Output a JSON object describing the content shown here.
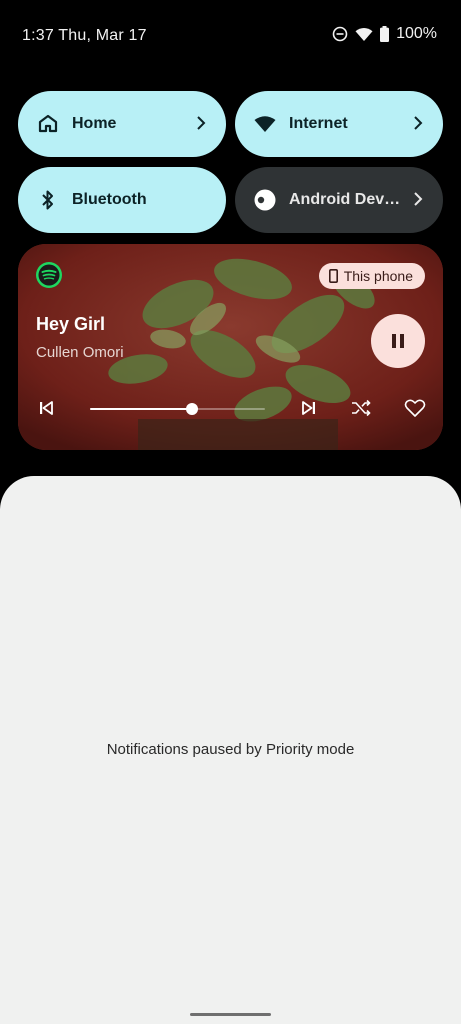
{
  "status_bar": {
    "time": "1:37 Thu, Mar 17",
    "battery": "100%",
    "icons": [
      "do-not-disturb-icon",
      "wifi-icon",
      "battery-icon"
    ]
  },
  "tiles": [
    {
      "label": "Home",
      "icon": "home-icon",
      "state": "on",
      "has_chevron": true
    },
    {
      "label": "Internet",
      "icon": "wifi-icon",
      "state": "on",
      "has_chevron": true
    },
    {
      "label": "Bluetooth",
      "icon": "bluetooth-icon",
      "state": "on",
      "has_chevron": false
    },
    {
      "label": "Android Dev…",
      "icon": "toggle-icon",
      "state": "off",
      "has_chevron": true
    }
  ],
  "media": {
    "app_icon": "spotify-icon",
    "output_device": "This phone",
    "title": "Hey Girl",
    "artist": "Cullen Omori",
    "progress": 0.58,
    "playing": true
  },
  "notifications": {
    "empty_message": "Notifications paused by Priority mode"
  },
  "colors": {
    "tile_on": "#b8f0f6",
    "tile_off": "#2f3335",
    "chip": "#fbe0dc",
    "shade": "#f0f1f0"
  }
}
